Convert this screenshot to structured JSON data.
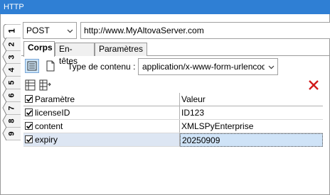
{
  "window": {
    "title": "HTTP"
  },
  "side_tabs": [
    "1",
    "2",
    "3",
    "4",
    "5",
    "6",
    "7",
    "8",
    "9"
  ],
  "request": {
    "method": "POST",
    "url": "http://www.MyAltovaServer.com"
  },
  "tabs": [
    {
      "label": "Corps",
      "active": true
    },
    {
      "label": "En-têtes",
      "active": false
    },
    {
      "label": "Paramètres",
      "active": false
    }
  ],
  "body_toolbar": {
    "content_type_label": "Type de contenu :",
    "content_type_value": "application/x-www-form-urlencoded"
  },
  "table": {
    "columns": [
      "Paramètre",
      "Valeur"
    ],
    "rows": [
      {
        "checked": true,
        "name": "licenseID",
        "value": "ID123"
      },
      {
        "checked": true,
        "name": "content",
        "value": "XMLSPyEnterprise"
      },
      {
        "checked": true,
        "name": "expiry",
        "value": "20250909",
        "selected": true
      }
    ]
  },
  "colors": {
    "titlebar": "#2f7fd4",
    "delete_icon": "#d11a1a",
    "selection": "#cfe3f7"
  }
}
